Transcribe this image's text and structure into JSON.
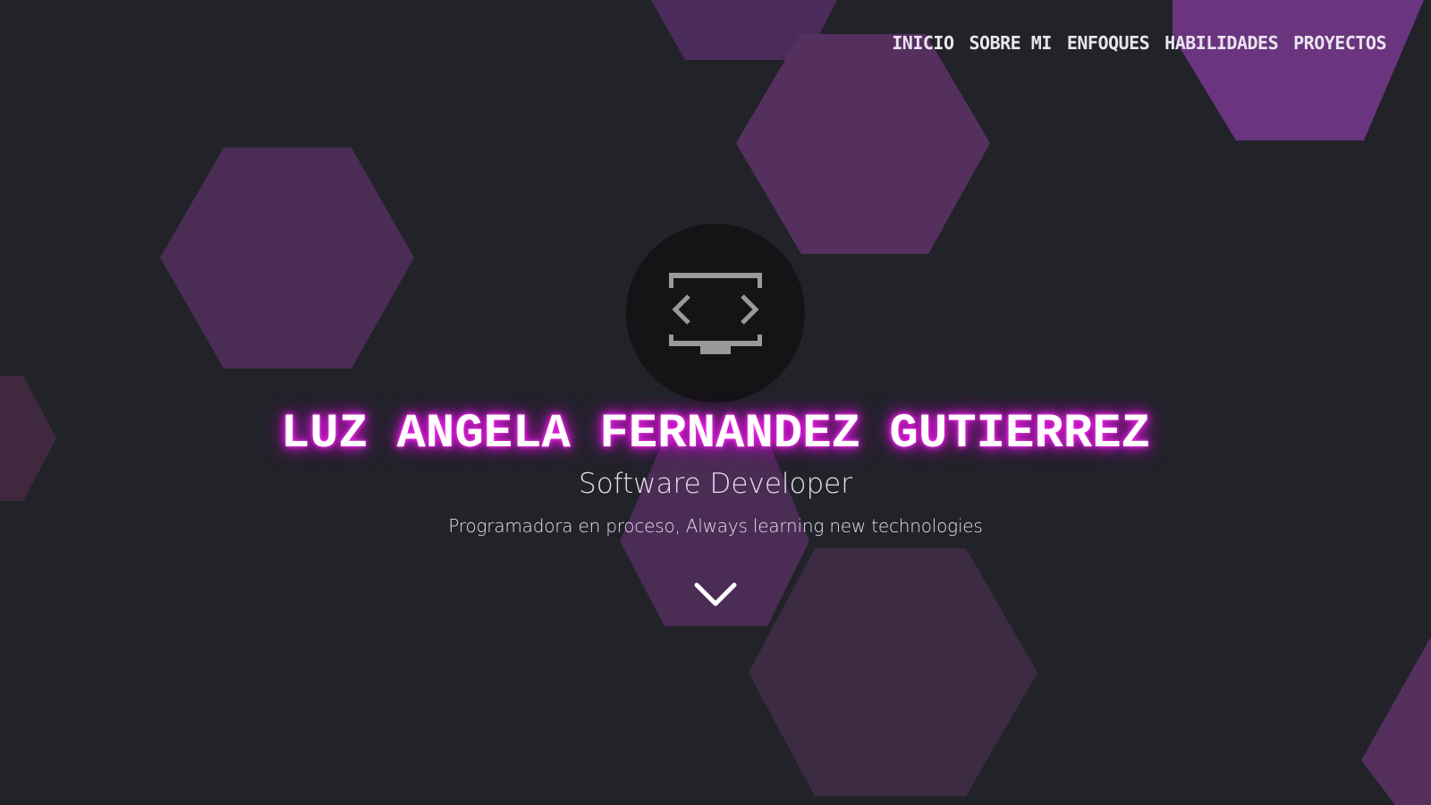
{
  "nav": {
    "items": [
      {
        "label": "INICIO"
      },
      {
        "label": "SOBRE MI"
      },
      {
        "label": "ENFOQUES"
      },
      {
        "label": "HABILIDADES"
      },
      {
        "label": "PROYECTOS"
      }
    ]
  },
  "hero": {
    "logo_icon": "code-monitor-icon",
    "name": "LUZ ANGELA FERNANDEZ GUTIERREZ",
    "role": "Software Developer",
    "tagline": "Programadora en proceso, Always learning new technologies",
    "scroll_icon": "chevron-down-icon"
  },
  "colors": {
    "background": "#212329",
    "hexagon": "#7a3593",
    "name_glow": "#e21ee0",
    "logo_bg": "#131416",
    "logo_fg": "#9a9a9a"
  }
}
